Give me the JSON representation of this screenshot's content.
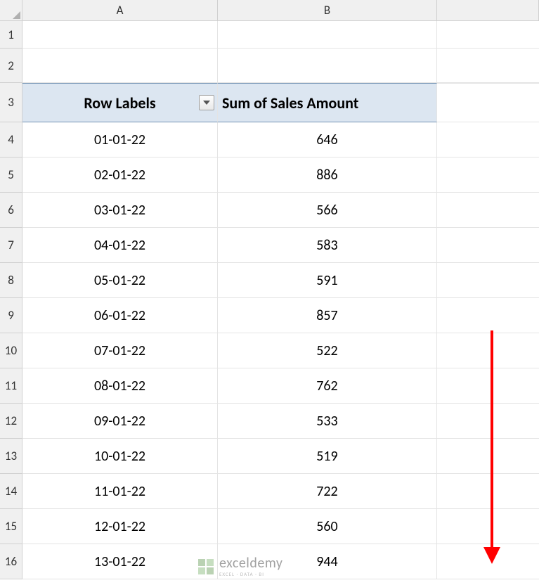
{
  "columns": [
    "A",
    "B",
    ""
  ],
  "row_numbers": [
    "1",
    "2",
    "3",
    "4",
    "5",
    "6",
    "7",
    "8",
    "9",
    "10",
    "11",
    "12",
    "13",
    "14",
    "15",
    "16"
  ],
  "pivot": {
    "headers": {
      "row_labels": "Row Labels",
      "sum_col": "Sum of Sales Amount"
    },
    "rows": [
      {
        "date": "01-01-22",
        "value": "646"
      },
      {
        "date": "02-01-22",
        "value": "886"
      },
      {
        "date": "03-01-22",
        "value": "566"
      },
      {
        "date": "04-01-22",
        "value": "583"
      },
      {
        "date": "05-01-22",
        "value": "591"
      },
      {
        "date": "06-01-22",
        "value": "857"
      },
      {
        "date": "07-01-22",
        "value": "522"
      },
      {
        "date": "08-01-22",
        "value": "762"
      },
      {
        "date": "09-01-22",
        "value": "533"
      },
      {
        "date": "10-01-22",
        "value": "519"
      },
      {
        "date": "11-01-22",
        "value": "722"
      },
      {
        "date": "12-01-22",
        "value": "560"
      },
      {
        "date": "13-01-22",
        "value": "944"
      }
    ]
  },
  "watermark": {
    "brand": "exceldemy",
    "tagline": "EXCEL · DATA · BI"
  }
}
